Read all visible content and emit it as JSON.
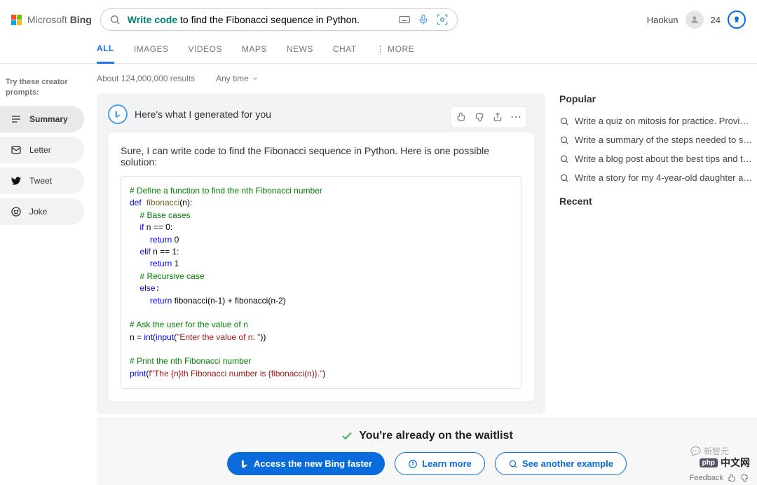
{
  "logo": {
    "brand": "Microsoft",
    "product": "Bing"
  },
  "search": {
    "prefix": "Write code",
    "rest": " to find the Fibonacci sequence in Python."
  },
  "user": {
    "name": "Haokun",
    "points": "24"
  },
  "tabs": {
    "all": "ALL",
    "images": "IMAGES",
    "videos": "VIDEOS",
    "maps": "MAPS",
    "news": "NEWS",
    "chat": "CHAT",
    "more": "MORE"
  },
  "sidebar": {
    "title": "Try these creator prompts:",
    "items": [
      {
        "label": "Summary"
      },
      {
        "label": "Letter"
      },
      {
        "label": "Tweet"
      },
      {
        "label": "Joke"
      }
    ]
  },
  "meta": {
    "results": "About 124,000,000 results",
    "anytime": "Any time"
  },
  "answer": {
    "header": "Here's what I generated for you",
    "intro": "Sure, I can write code to find the Fibonacci sequence in Python. Here is one possible solution:",
    "code": {
      "c1": "# Define a function to find the nth Fibonacci number",
      "l_def": "def",
      "l_fn": "fibonacci",
      "l_params": "(n):",
      "c2": "# Base cases",
      "l_if": "if",
      "l_ifcond": " n == 0:",
      "l_ret1": "return",
      "l_ret1v": " 0",
      "l_elif": "elif",
      "l_elifcond": " n == 1:",
      "l_ret2": "return",
      "l_ret2v": " 1",
      "c3": "# Recursive case",
      "l_else": "else",
      "l_ret3": "return",
      "l_ret3v": " fibonacci(n-1) + fibonacci(n-2)",
      "c4": "# Ask the user for the value of n",
      "l_n": "n = ",
      "l_int": "int",
      "l_input": "input",
      "l_open": "(",
      "l_open2": "(",
      "l_prompt": "\"Enter the value of n: \"",
      "l_close": "))",
      "c5": "# Print the nth Fibonacci number",
      "l_print": "print",
      "l_fstr": "f\"The {n}th Fibonacci number is {fibonacci(n)}.\"",
      "l_print_open": "(",
      "l_print_close": ")"
    }
  },
  "rightcol": {
    "popular_title": "Popular",
    "popular": [
      "Write a quiz on mitosis for practice. Provi…",
      "Write a summary of the steps needed to s…",
      "Write a blog post about the best tips and t…",
      "Write a story for my 4-year-old daughter a…"
    ],
    "recent_title": "Recent"
  },
  "bottom": {
    "title": "You're already on the waitlist",
    "btn_primary": "Access the new Bing faster",
    "btn_learn": "Learn more",
    "btn_another": "See another example"
  },
  "footer": {
    "feedback": "Feedback"
  },
  "watermark": {
    "text1": "新智元",
    "php": "php",
    "text2": "中文网"
  }
}
